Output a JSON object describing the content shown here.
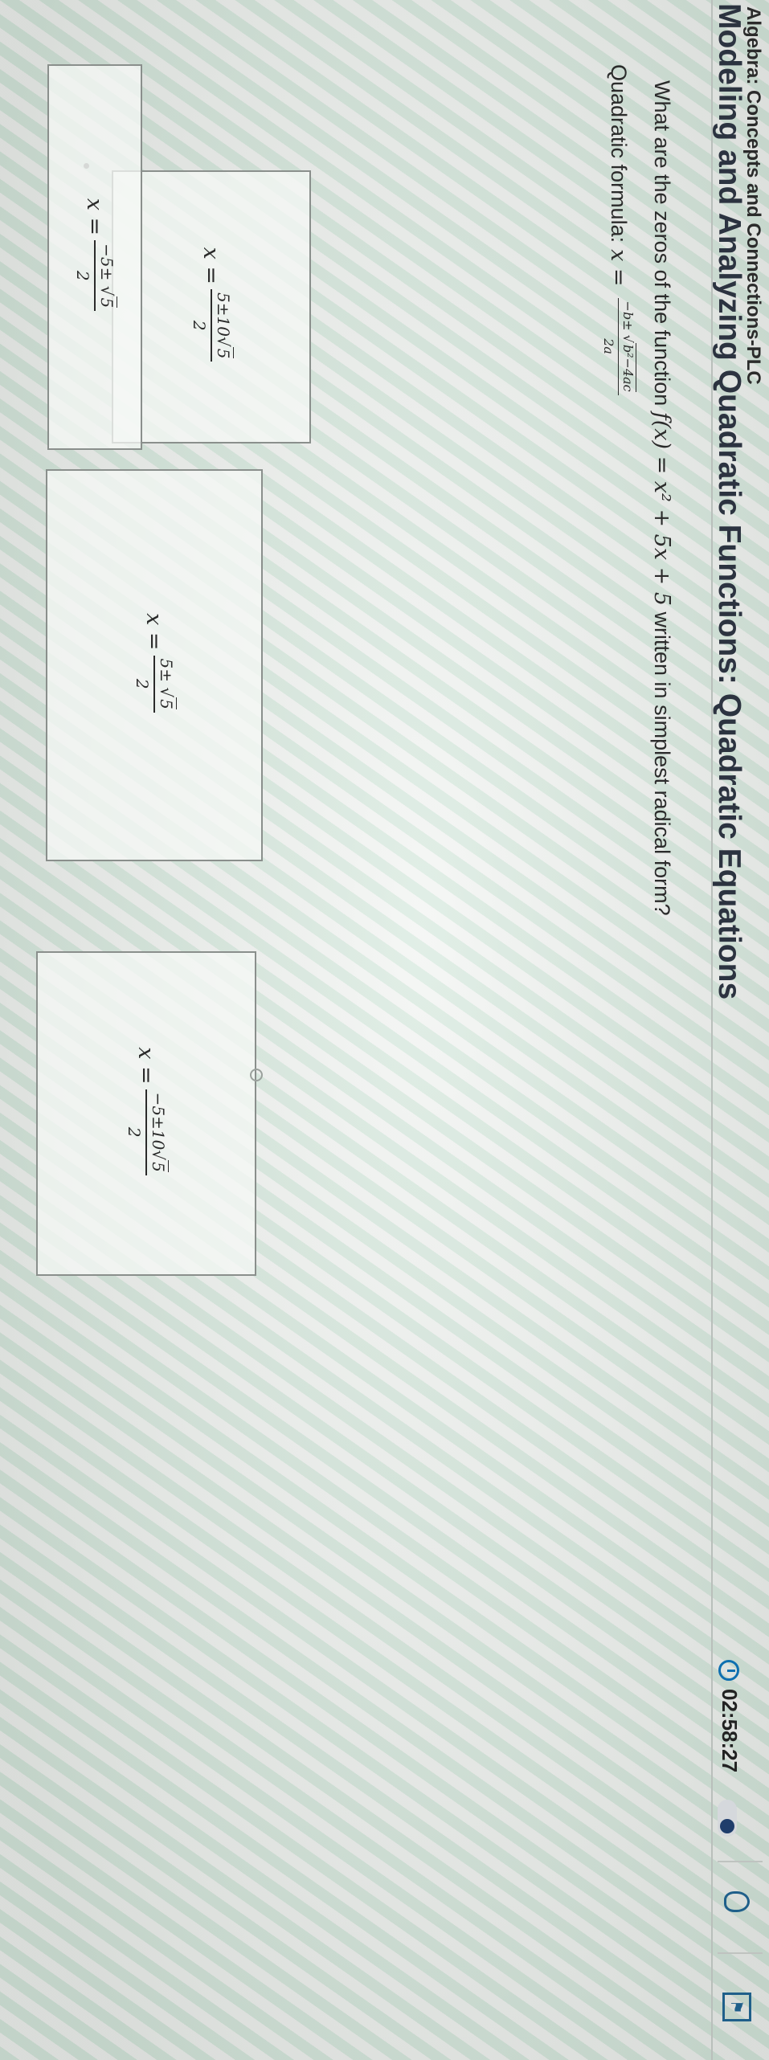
{
  "header": {
    "course": "Algebra: Concepts and Connections-PLC",
    "unit_title": "Modeling and Analyzing Quadratic Functions: Quadratic Equations",
    "timer": "02:58:27"
  },
  "question": {
    "prefix": "What are the zeros of the function ",
    "function": "f(x) = x² + 5x + 5",
    "suffix": " written in simplest radical form?"
  },
  "formula": {
    "label": "Quadratic formula: ",
    "lhs": "x =",
    "numerator_pre": "−b± ",
    "radicand": "b²−4ac",
    "denominator": "2a"
  },
  "choices": [
    {
      "lhs": "x =",
      "num_pre": "5±10",
      "radicand": "5",
      "den": "2"
    },
    {
      "lhs": "x =",
      "num_pre": "5± ",
      "radicand": "5",
      "den": "2"
    },
    {
      "lhs": "x =",
      "num_pre": "−5±10",
      "radicand": "5",
      "den": "2"
    },
    {
      "lhs": "x =",
      "num_pre": "−5± ",
      "radicand": "5",
      "den": "2"
    }
  ],
  "colors": {
    "accent": "#0f6fb0",
    "title": "#2c3340",
    "border": "#8a8f8c"
  },
  "icons": {
    "timer": "stopwatch-icon",
    "hint": "lightbulb-icon",
    "corner": "flag-icon"
  }
}
